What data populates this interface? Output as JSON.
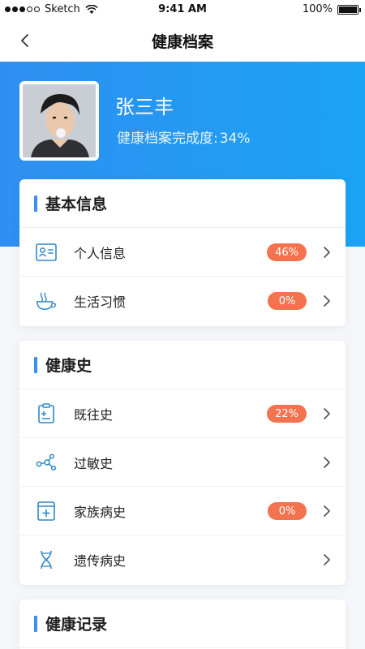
{
  "status_bar": {
    "carrier": "Sketch",
    "time": "9:41 AM",
    "battery": "100%"
  },
  "nav": {
    "title": "健康档案"
  },
  "profile": {
    "name": "张三丰",
    "completion_label": "健康档案完成度:",
    "completion_value": "34%"
  },
  "sections": [
    {
      "title": "基本信息",
      "items": [
        {
          "label": "个人信息",
          "badge": "46%",
          "icon": "id-card-icon"
        },
        {
          "label": "生活习惯",
          "badge": "0%",
          "icon": "coffee-cup-icon"
        }
      ]
    },
    {
      "title": "健康史",
      "items": [
        {
          "label": "既往史",
          "badge": "22%",
          "icon": "clipboard-icon"
        },
        {
          "label": "过敏史",
          "badge": null,
          "icon": "molecule-icon"
        },
        {
          "label": "家族病史",
          "badge": "0%",
          "icon": "medical-book-icon"
        },
        {
          "label": "遗传病史",
          "badge": null,
          "icon": "dna-icon"
        }
      ]
    },
    {
      "title": "健康记录",
      "items": []
    }
  ],
  "colors": {
    "accent": "#3a8ff0",
    "badge": "#f4734f",
    "header_start": "#2f8ff0",
    "header_end": "#1aa3f5",
    "icon": "#2f88c6"
  }
}
